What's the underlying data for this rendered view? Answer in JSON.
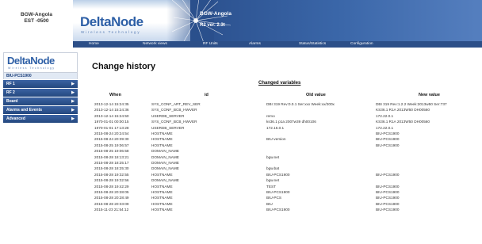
{
  "device": {
    "name": "BGW-Angola",
    "timezone": "EST -0500"
  },
  "banner": {
    "logo": "DeltaNode",
    "tagline": "Wireless Technology",
    "title": "BGW-Angola",
    "version": "R2 ver. 2.3t"
  },
  "nav": [
    {
      "label": "Home"
    },
    {
      "label": "Network views"
    },
    {
      "label": "RF Units"
    },
    {
      "label": "Alarms"
    },
    {
      "label": "Status/Statistics"
    },
    {
      "label": "Configuration"
    }
  ],
  "sidebar": {
    "logo": "DeltaNode",
    "tagline": "Wireless Technology",
    "device": "BIU-PCS1900",
    "items": [
      {
        "label": "RF 1"
      },
      {
        "label": "RF 2"
      },
      {
        "label": "Board"
      },
      {
        "label": "Alarms and Events"
      },
      {
        "label": "Advanced"
      }
    ]
  },
  "page": {
    "title": "Change history",
    "section": "Changed variables"
  },
  "table": {
    "headers": {
      "when": "When",
      "id": "id",
      "old": "Old value",
      "new": "New value"
    },
    "rows": [
      {
        "when": "2013-12-14 15:24:35",
        "id": "SYS_CONF_ART_REV_SER",
        "old": "DBI 319 Rev:0.0.1 Ser:xxx Week:xx/200x",
        "new": "DBI 319 Rev:1.2.2 Week:2013w50 Ser:737"
      },
      {
        "when": "2013-12-14 15:24:36",
        "id": "SYS_CONF_BCB_HWVER",
        "old": "",
        "new": "KS36.1 R1A 2013W50 DH00560"
      },
      {
        "when": "2013-12-14 15:24:50",
        "id": "USERDB_SERVER",
        "old": "remo",
        "new": "172.22.0.1"
      },
      {
        "when": "1970-01-01 00:00:15",
        "id": "SYS_CONF_BCB_HWVER",
        "old": "ks36.1 p1a 2007w39 dh00106",
        "new": "KS36.1 R1A 2013W50 DH00560"
      },
      {
        "when": "1970-01-01 17:13:28",
        "id": "USERDB_SERVER",
        "old": "172.16.0.1",
        "new": "172.22.0.1"
      },
      {
        "when": "2015-08-24 20:24:54",
        "id": "HOSTNAME",
        "old": "",
        "new": "BIU-PCS1900"
      },
      {
        "when": "2015-08-24 20:39:30",
        "id": "HOSTNAME",
        "old": "BIU-version",
        "new": "BIU-PCS1900"
      },
      {
        "when": "2015-08-25 19:06:57",
        "id": "HOSTNAME",
        "old": "",
        "new": "BIU-PCS1900"
      },
      {
        "when": "2015-08-25 19:06:58",
        "id": "DOMAIN_NAME",
        "old": "",
        "new": ""
      },
      {
        "when": "2015-08-28 18:13:21",
        "id": "DOMAIN_NAME",
        "old": "bgw.net",
        "new": ""
      },
      {
        "when": "2015-08-28 18:25:17",
        "id": "DOMAIN_NAME",
        "old": "",
        "new": ""
      },
      {
        "when": "2015-08-28 18:25:30",
        "id": "DOMAIN_NAME",
        "old": "bgw.bat",
        "new": ""
      },
      {
        "when": "2015-08-28 19:32:55",
        "id": "HOSTNAME",
        "old": "BIU-PCS1900",
        "new": "BIU-PCS1900"
      },
      {
        "when": "2015-08-28 19:32:56",
        "id": "DOMAIN_NAME",
        "old": "bgw.net",
        "new": ""
      },
      {
        "when": "2015-08-28 19:42:29",
        "id": "HOSTNAME",
        "old": "TEST",
        "new": "BIU-PCS1900"
      },
      {
        "when": "2015-08-28 20:28:05",
        "id": "HOSTNAME",
        "old": "BIU-PCS1900",
        "new": "BIU-PCS1900"
      },
      {
        "when": "2015-08-28 20:28:49",
        "id": "HOSTNAME",
        "old": "BIU-PCS",
        "new": "BIU-PCS1900"
      },
      {
        "when": "2015-08-28 20:33:09",
        "id": "HOSTNAME",
        "old": "BIU",
        "new": "BIU-PCS1900"
      },
      {
        "when": "2015-11-23 21:54:12",
        "id": "HOSTNAME",
        "old": "BIU-PCS1900",
        "new": "BIU-PCS1900"
      }
    ]
  }
}
